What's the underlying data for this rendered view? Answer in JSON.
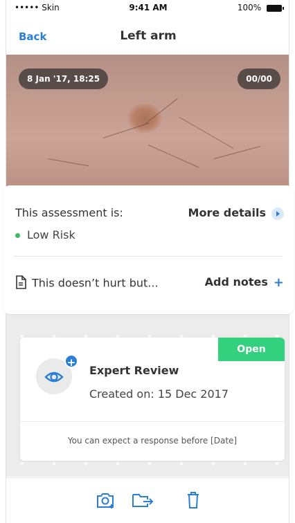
{
  "status_bar": {
    "carrier": "••••• Skin",
    "time": "9:41 AM",
    "battery": "100%"
  },
  "nav": {
    "back_label": "Back",
    "title": "Left arm"
  },
  "photo": {
    "date": "8 Jan '17, 18:25",
    "counter": "00/00"
  },
  "assessment": {
    "label": "This assessment is:",
    "more_details": "More details",
    "risk": "Low Risk",
    "risk_color": "#3fbb67",
    "note_text": "This doesn’t hurt but...",
    "add_notes": "Add notes",
    "add_notes_icon": "+"
  },
  "review": {
    "status": "Open",
    "status_color": "#33d07e",
    "title": "Expert Review",
    "created": "Created on: 15 Dec 2017",
    "expectation": "You can expect a response before [Date]",
    "add_icon": "+"
  },
  "toolbar": {
    "icons": [
      "add-photo-icon",
      "move-icon",
      "delete-icon"
    ]
  },
  "colors": {
    "accent": "#2a7fd4"
  }
}
